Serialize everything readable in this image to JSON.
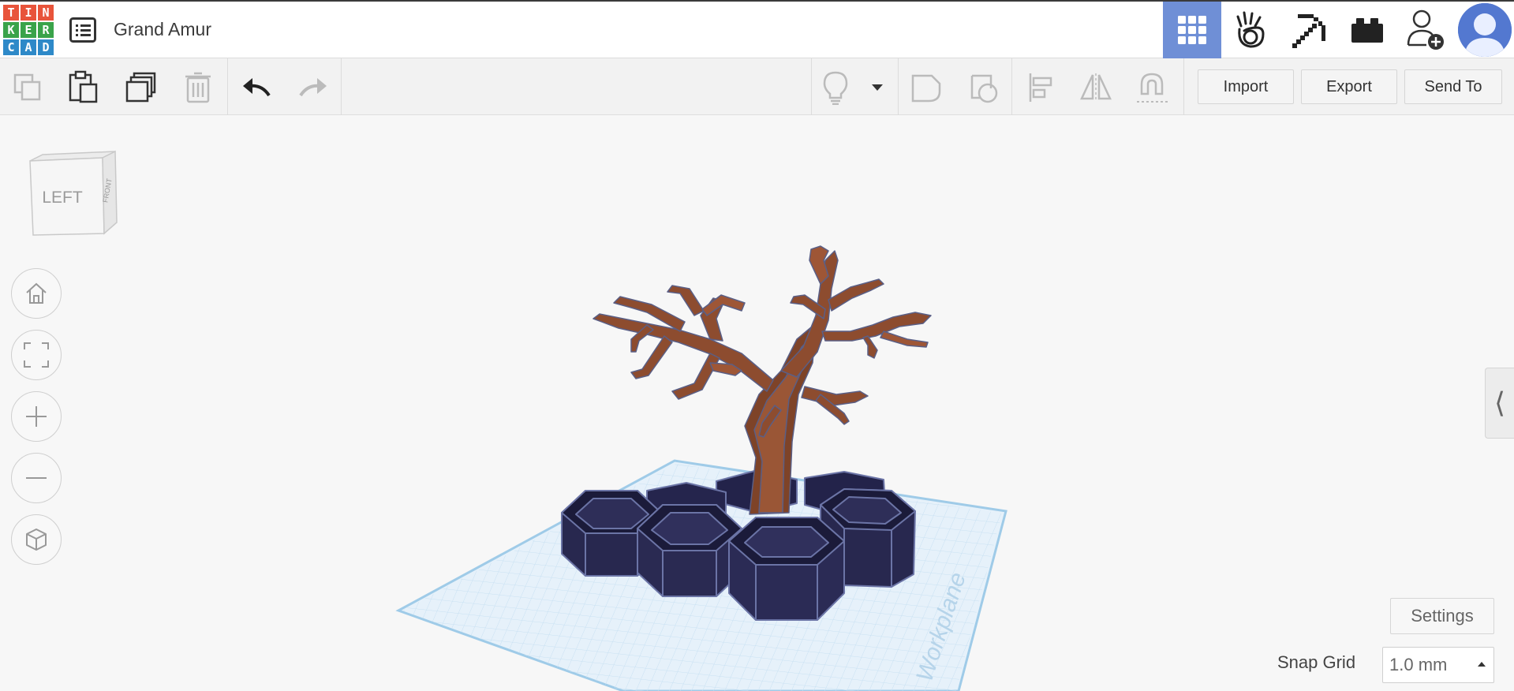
{
  "app": {
    "logo_letters": [
      "T",
      "I",
      "N",
      "K",
      "E",
      "R",
      "C",
      "A",
      "D"
    ],
    "logo_colors": [
      "#e8543b",
      "#e8543b",
      "#e8543b",
      "#3aa34a",
      "#3aa34a",
      "#3aa34a",
      "#2e89c8",
      "#2e89c8",
      "#2e89c8"
    ],
    "accent": "#6f8fd6"
  },
  "header": {
    "design_title": "Grand Amur",
    "menu_icon": "list-icon",
    "tools": [
      {
        "name": "3d-design",
        "icon": "grid-icon",
        "active": true
      },
      {
        "name": "simulate",
        "icon": "hand-icon"
      },
      {
        "name": "minecraft",
        "icon": "pickaxe-icon"
      },
      {
        "name": "bricks",
        "icon": "brick-icon"
      },
      {
        "name": "invite",
        "icon": "add-user-icon"
      }
    ]
  },
  "toolbar": {
    "import_label": "Import",
    "export_label": "Export",
    "send_to_label": "Send To"
  },
  "viewcube": {
    "face_left": "LEFT",
    "face_front": "FRONT"
  },
  "workplane": {
    "label": "Workplane",
    "grid_color": "#d4e9f7"
  },
  "model": {
    "base_color": "#2c2c54",
    "trunk_color": "#8a4a2f"
  },
  "settings_label": "Settings",
  "snap": {
    "label": "Snap Grid",
    "value": "1.0 mm"
  }
}
